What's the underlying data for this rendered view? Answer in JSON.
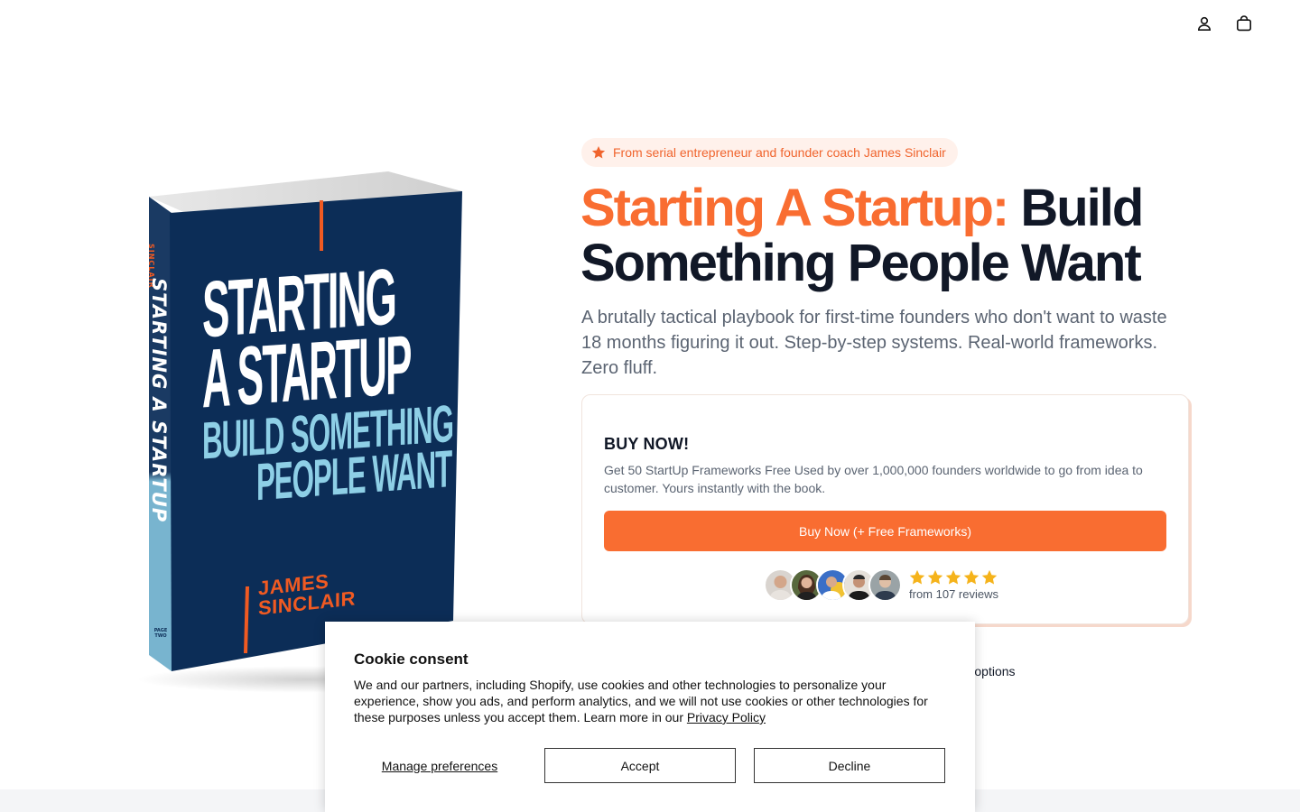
{
  "header": {
    "account_icon": "user-icon",
    "cart_icon": "shopping-bag-icon"
  },
  "book": {
    "spine_author": "SINCLAIR",
    "spine_title": "STARTING A STARTUP",
    "cover_line1": "STARTING",
    "cover_line2": "A STARTUP",
    "cover_line3": "BUILD SOMETHING",
    "cover_line4": "PEOPLE WANT",
    "cover_author_first": "JAMES",
    "cover_author_last": "SINCLAIR",
    "publisher": "PAGE TWO",
    "colors": {
      "cover": "#0c2d57",
      "spine": "#78b4cf",
      "accent": "#f05a22",
      "subtitle": "#8ecfe6"
    }
  },
  "hero": {
    "badge_icon": "star-icon",
    "badge_text": "From serial entrepreneur and founder coach James Sinclair",
    "title_accent": "Starting A Startup:",
    "title_rest": " Build Something People Want",
    "subtitle": "A brutally tactical playbook for first-time founders who don't want to waste 18 months figuring it out. Step-by-step systems. Real-world frameworks. Zero fluff."
  },
  "buy_card": {
    "title": "BUY NOW!",
    "description": "Get 50 StartUp Frameworks Free Used by over 1,000,000 founders worldwide to go from idea to customer. Yours instantly with the book.",
    "button_label": "Buy Now (+ Free Frameworks)",
    "rating_stars": 5,
    "reviews_text": "from 107 reviews",
    "avatar_count": 5
  },
  "purchase_options": {
    "label": "rchase options"
  },
  "cookie": {
    "title": "Cookie consent",
    "text": "We and our partners, including Shopify, use cookies and other technologies to personalize your experience, show you ads, and perform analytics, and we will not use cookies or other technologies for these purposes unless you accept them. Learn more in our ",
    "privacy_link": "Privacy Policy",
    "manage_label": "Manage preferences",
    "accept_label": "Accept",
    "decline_label": "Decline"
  },
  "colors": {
    "accent": "#f96d31",
    "text_dark": "#111827",
    "text_muted": "#5b6472",
    "badge_bg": "#fff1eb",
    "star": "#f5b31b"
  }
}
